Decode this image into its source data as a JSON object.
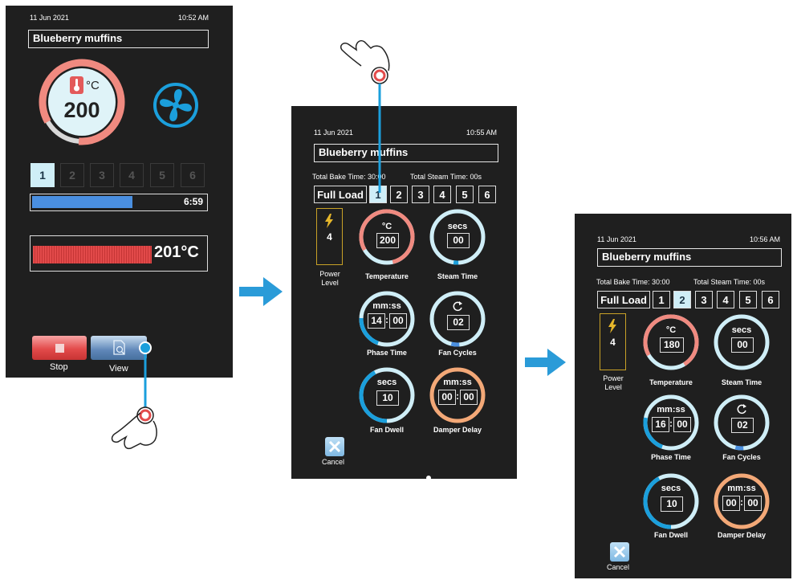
{
  "screen1": {
    "date": "11 Jun 2021",
    "time": "10:52 AM",
    "recipe": "Blueberry muffins",
    "temp_unit": "°C",
    "temperature": "200",
    "phases": [
      "1",
      "2",
      "3",
      "4",
      "5",
      "6"
    ],
    "active_phase": "1",
    "progress_time": "6:59",
    "progress_fraction": 0.58,
    "oven_reading": "201°C",
    "stop_label": "Stop",
    "view_label": "View"
  },
  "screen2": {
    "date": "11 Jun 2021",
    "time": "10:55 AM",
    "recipe": "Blueberry muffins",
    "total_bake": "Total Bake Time: 30:00",
    "total_steam": "Total Steam Time: 00s",
    "load_label": "Full Load",
    "phases": [
      "1",
      "2",
      "3",
      "4",
      "5",
      "6"
    ],
    "active_phase": "1",
    "power_level": "4",
    "power_label_1": "Power",
    "power_label_2": "Level",
    "dials": {
      "temperature": {
        "unit": "°C",
        "value": "200",
        "label": "Temperature"
      },
      "steam_time": {
        "unit": "secs",
        "value": "00",
        "label": "Steam Time"
      },
      "phase_time": {
        "unit": "mm:ss",
        "mm": "14",
        "ss": "00",
        "label": "Phase Time"
      },
      "fan_cycles": {
        "value": "02",
        "label": "Fan Cycles"
      },
      "fan_dwell": {
        "unit": "secs",
        "value": "10",
        "label": "Fan Dwell"
      },
      "damper_delay": {
        "unit": "mm:ss",
        "mm": "00",
        "ss": "00",
        "label": "Damper Delay"
      }
    },
    "cancel_label": "Cancel"
  },
  "screen3": {
    "date": "11 Jun 2021",
    "time": "10:56 AM",
    "recipe": "Blueberry muffins",
    "total_bake": "Total Bake Time: 30:00",
    "total_steam": "Total Steam Time: 00s",
    "load_label": "Full Load",
    "phases": [
      "1",
      "2",
      "3",
      "4",
      "5",
      "6"
    ],
    "active_phase": "2",
    "power_level": "4",
    "power_label_1": "Power",
    "power_label_2": "Level",
    "dials": {
      "temperature": {
        "unit": "°C",
        "value": "180",
        "label": "Temperature"
      },
      "steam_time": {
        "unit": "secs",
        "value": "00",
        "label": "Steam Time"
      },
      "phase_time": {
        "unit": "mm:ss",
        "mm": "16",
        "ss": "00",
        "label": "Phase Time"
      },
      "fan_cycles": {
        "value": "02",
        "label": "Fan Cycles"
      },
      "fan_dwell": {
        "unit": "secs",
        "value": "10",
        "label": "Fan Dwell"
      },
      "damper_delay": {
        "unit": "mm:ss",
        "mm": "00",
        "ss": "00",
        "label": "Damper Delay"
      }
    },
    "cancel_label": "Cancel"
  },
  "colors": {
    "screen_bg": "#1f1f1f",
    "accent_blue": "#1b9fdc",
    "temp_ring": "#f08a80",
    "dial_ring": "#cfeef7",
    "damper_ring": "#f3a877",
    "progress_blue": "#4a8fe0",
    "power_gold": "#c9a227",
    "stop_red": "#e34b4b"
  }
}
